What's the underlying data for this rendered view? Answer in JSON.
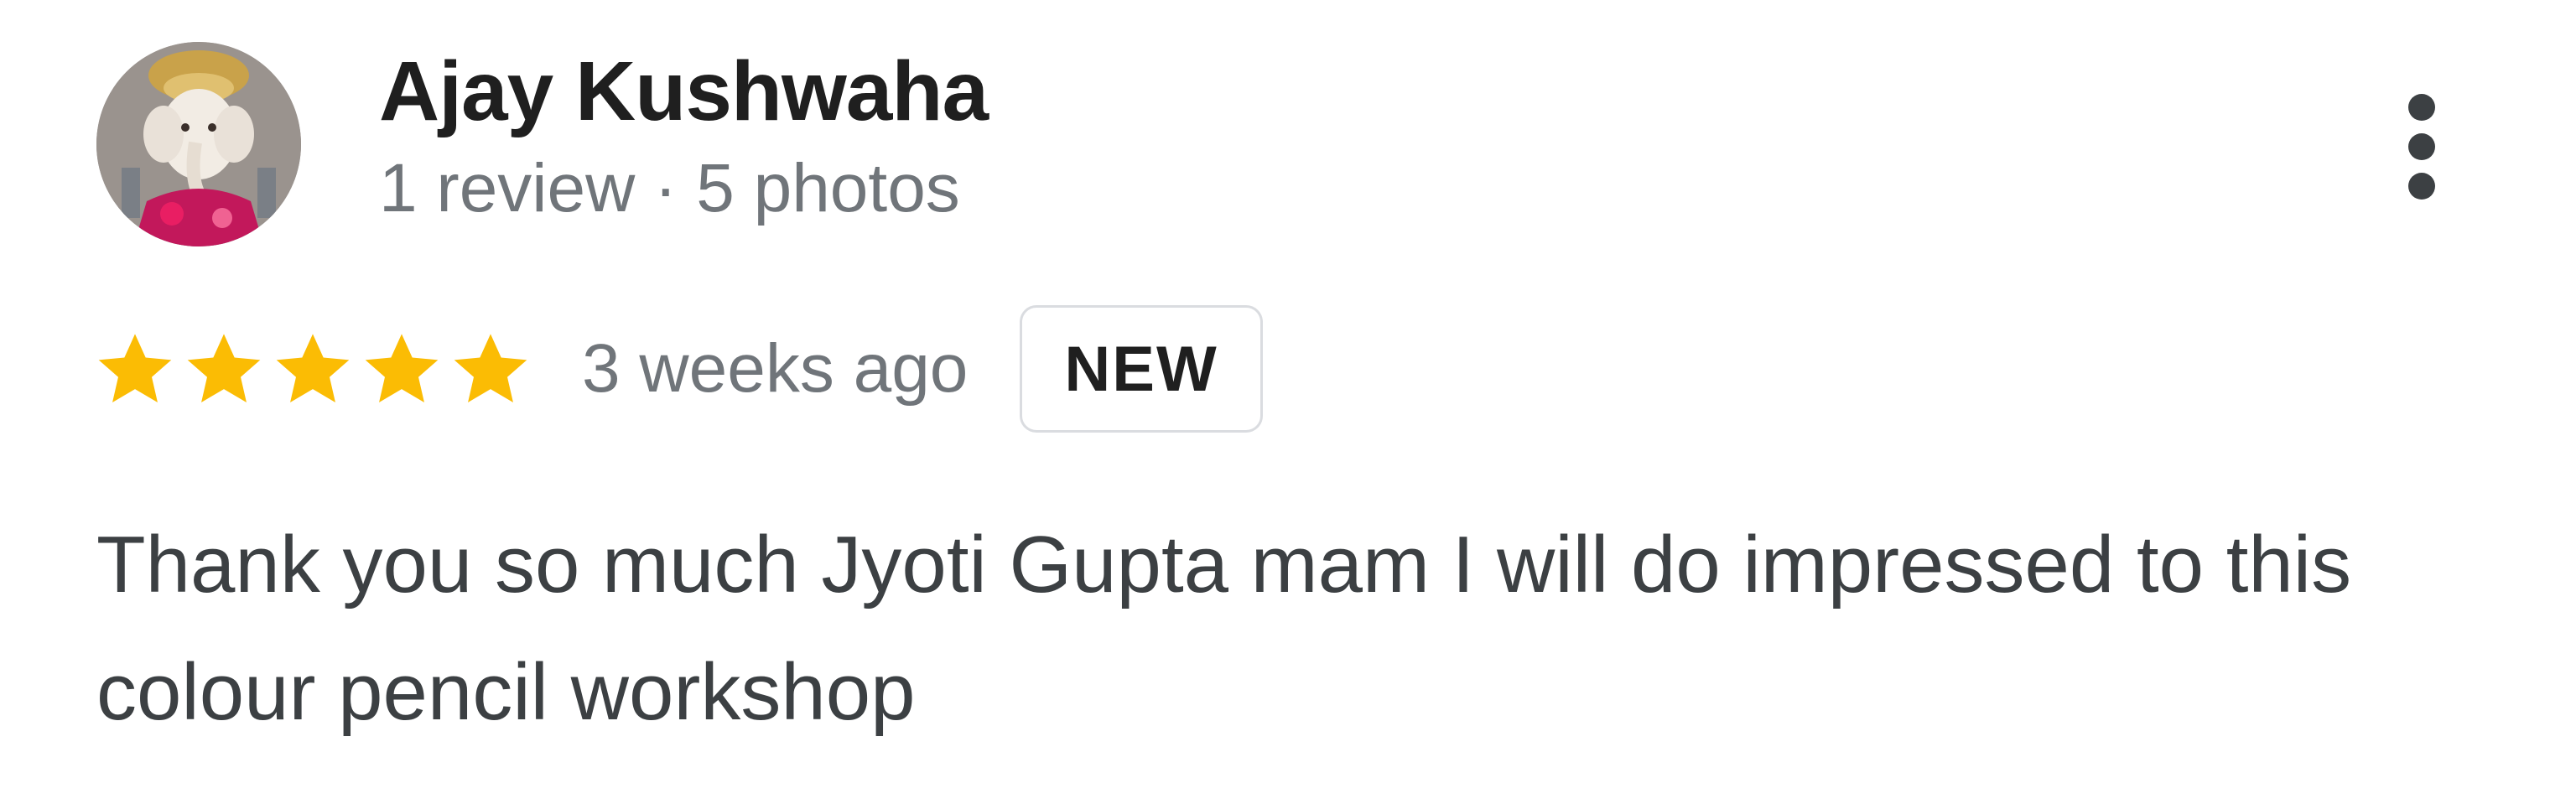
{
  "review": {
    "reviewer": {
      "name": "Ajay Kushwaha",
      "meta": "1 review · 5 photos",
      "avatar_icon": "deity-portrait-avatar"
    },
    "rating": {
      "stars": 5,
      "max_stars": 5,
      "star_color": "#fbbc04"
    },
    "time": "3 weeks ago",
    "badge": "NEW",
    "text": "Thank you so much Jyoti Gupta mam I will do impressed to this colour pencil workshop",
    "more_icon": "more-vert-icon"
  }
}
